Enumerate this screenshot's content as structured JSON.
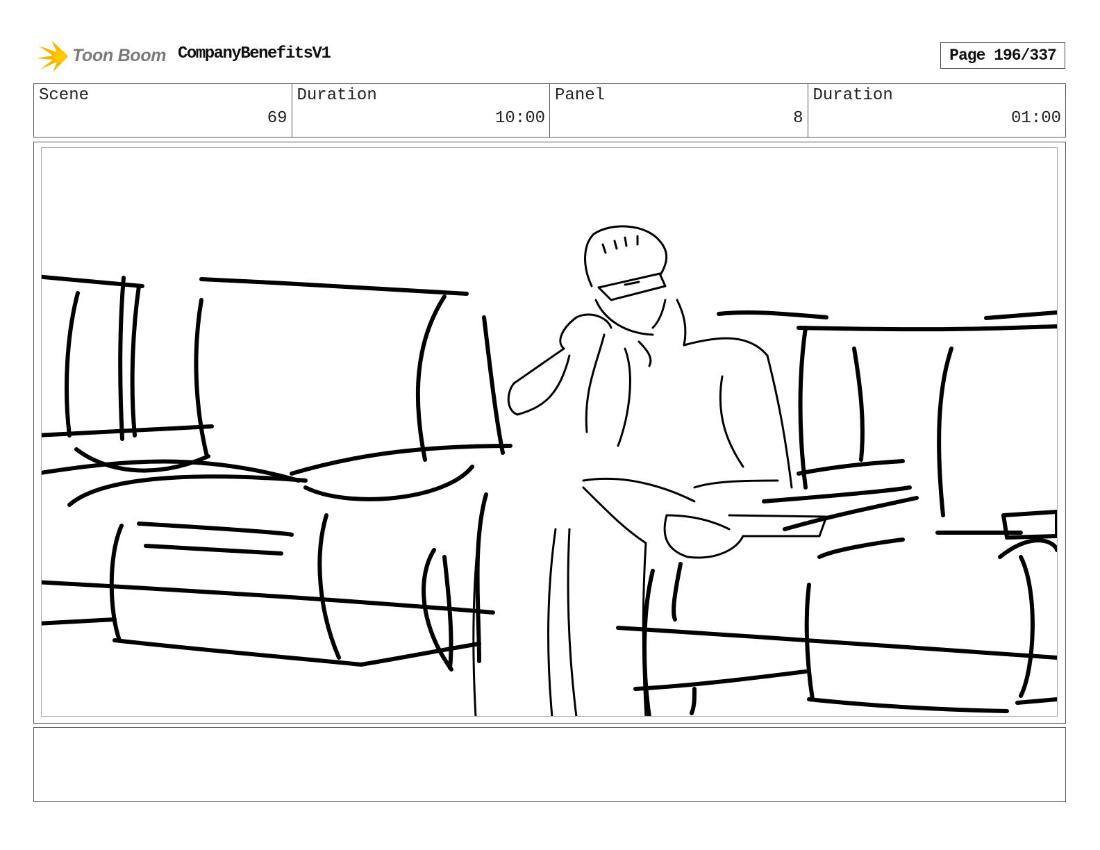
{
  "header": {
    "logo_text": "Toon Boom",
    "title": "CompanyBenefitsV1",
    "page_label": "Page 196/337"
  },
  "info": [
    {
      "label": "Scene",
      "value": "69"
    },
    {
      "label": "Duration",
      "value": "10:00"
    },
    {
      "label": "Panel",
      "value": "8"
    },
    {
      "label": "Duration",
      "value": "01:00"
    }
  ],
  "panel": {
    "notes": ""
  },
  "colors": {
    "logo_accent": "#f5b800",
    "logo_text": "#7a7a7a",
    "border": "#555555"
  }
}
